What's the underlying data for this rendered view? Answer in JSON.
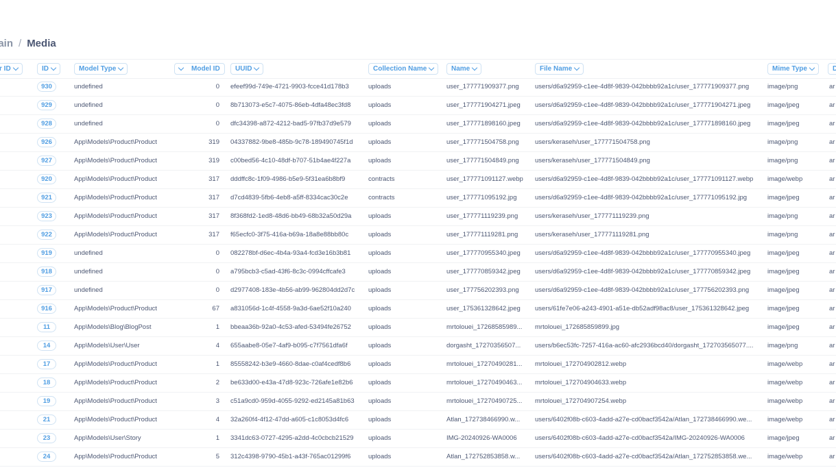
{
  "breadcrumb": {
    "parent": "main",
    "separator": "/",
    "current": "Media"
  },
  "columns": [
    {
      "key": "user_id",
      "label": "r ID"
    },
    {
      "key": "id",
      "label": "ID"
    },
    {
      "key": "model_type",
      "label": "Model Type"
    },
    {
      "key": "model_id",
      "label": "Model ID"
    },
    {
      "key": "uuid",
      "label": "UUID"
    },
    {
      "key": "collection_name",
      "label": "Collection Name"
    },
    {
      "key": "name",
      "label": "Name"
    },
    {
      "key": "file_name",
      "label": "File Name"
    },
    {
      "key": "mime_type",
      "label": "Mime Type"
    },
    {
      "key": "disk",
      "label": "D"
    }
  ],
  "rows": [
    {
      "id": "930",
      "model_type": "undefined",
      "model_id": "0",
      "uuid": "efeef99d-749e-4721-9903-fcce41d178b3",
      "collection_name": "uploads",
      "name": "user_177771909377.png",
      "file_name": "users/d6a92959-c1ee-4d8f-9839-042bbbb92a1c/user_177771909377.png",
      "mime_type": "image/png",
      "disk": "ar"
    },
    {
      "id": "929",
      "model_type": "undefined",
      "model_id": "0",
      "uuid": "8b713073-e5c7-4075-86eb-4dfa48ec3fd8",
      "collection_name": "uploads",
      "name": "user_177771904271.jpeg",
      "file_name": "users/d6a92959-c1ee-4d8f-9839-042bbbb92a1c/user_177771904271.jpeg",
      "mime_type": "image/jpeg",
      "disk": "ar"
    },
    {
      "id": "928",
      "model_type": "undefined",
      "model_id": "0",
      "uuid": "dfc34398-a872-4212-bad5-97fb37d9e579",
      "collection_name": "uploads",
      "name": "user_177771898160.jpeg",
      "file_name": "users/d6a92959-c1ee-4d8f-9839-042bbbb92a1c/user_177771898160.jpeg",
      "mime_type": "image/jpeg",
      "disk": "ar"
    },
    {
      "id": "926",
      "model_type": "App\\Models\\Product\\Product",
      "model_id": "319",
      "uuid": "04337882-9be8-485b-9c78-189490745f1d",
      "collection_name": "uploads",
      "name": "user_177771504758.png",
      "file_name": "users/keraseh/user_177771504758.png",
      "mime_type": "image/png",
      "disk": "ar"
    },
    {
      "id": "927",
      "model_type": "App\\Models\\Product\\Product",
      "model_id": "319",
      "uuid": "c00bed56-4c10-48df-b707-51b4ae4f227a",
      "collection_name": "uploads",
      "name": "user_177771504849.png",
      "file_name": "users/keraseh/user_177771504849.png",
      "mime_type": "image/png",
      "disk": "ar"
    },
    {
      "id": "920",
      "model_type": "App\\Models\\Product\\Product",
      "model_id": "317",
      "uuid": "dddffc8c-1f09-4986-b5e9-5f31ea6b8bf9",
      "collection_name": "contracts",
      "name": "user_177771091127.webp",
      "file_name": "users/d6a92959-c1ee-4d8f-9839-042bbbb92a1c/user_177771091127.webp",
      "mime_type": "image/webp",
      "disk": "ar"
    },
    {
      "id": "921",
      "model_type": "App\\Models\\Product\\Product",
      "model_id": "317",
      "uuid": "d7cd4839-5fb6-4eb8-a5ff-8334cac30c2e",
      "collection_name": "contracts",
      "name": "user_177771095192.jpg",
      "file_name": "users/d6a92959-c1ee-4d8f-9839-042bbbb92a1c/user_177771095192.jpg",
      "mime_type": "image/jpeg",
      "disk": "ar"
    },
    {
      "id": "923",
      "model_type": "App\\Models\\Product\\Product",
      "model_id": "317",
      "uuid": "8f368fd2-1ed8-48d6-bb49-68b32a50d29a",
      "collection_name": "uploads",
      "name": "user_177771119239.png",
      "file_name": "users/keraseh/user_177771119239.png",
      "mime_type": "image/png",
      "disk": "ar"
    },
    {
      "id": "922",
      "model_type": "App\\Models\\Product\\Product",
      "model_id": "317",
      "uuid": "f65ecfc0-3f75-416a-b69a-18a8e88bb80c",
      "collection_name": "uploads",
      "name": "user_177771119281.png",
      "file_name": "users/keraseh/user_177771119281.png",
      "mime_type": "image/png",
      "disk": "ar"
    },
    {
      "id": "919",
      "model_type": "undefined",
      "model_id": "0",
      "uuid": "082278bf-d6ec-4b4a-93a4-fcd3e16b3b81",
      "collection_name": "uploads",
      "name": "user_177770955340.jpeg",
      "file_name": "users/d6a92959-c1ee-4d8f-9839-042bbbb92a1c/user_177770955340.jpeg",
      "mime_type": "image/jpeg",
      "disk": "ar"
    },
    {
      "id": "918",
      "model_type": "undefined",
      "model_id": "0",
      "uuid": "a795bcb3-c5ad-43f6-8c3c-0994cffcafe3",
      "collection_name": "uploads",
      "name": "user_177770859342.jpeg",
      "file_name": "users/d6a92959-c1ee-4d8f-9839-042bbbb92a1c/user_177770859342.jpeg",
      "mime_type": "image/jpeg",
      "disk": "ar"
    },
    {
      "id": "917",
      "model_type": "undefined",
      "model_id": "0",
      "uuid": "d2977408-183e-4b56-ab99-962804dd2d7c",
      "collection_name": "uploads",
      "name": "user_177756202393.png",
      "file_name": "users/d6a92959-c1ee-4d8f-9839-042bbbb92a1c/user_177756202393.png",
      "mime_type": "image/jpeg",
      "disk": "ar"
    },
    {
      "id": "916",
      "model_type": "App\\Models\\Product\\Product",
      "model_id": "67",
      "uuid": "a831056d-1c4f-4558-9a3d-6ae52f10a240",
      "collection_name": "uploads",
      "name": "user_175361328642.jpeg",
      "file_name": "users/61fe7e06-a243-4901-a51e-db52adf98ac8/user_175361328642.jpeg",
      "mime_type": "image/jpeg",
      "disk": "ar"
    },
    {
      "id": "11",
      "model_type": "App\\Models\\Blog\\BlogPost",
      "model_id": "1",
      "uuid": "bbeaa36b-92a0-4c53-afed-53494fe26752",
      "collection_name": "uploads",
      "name": "mrtolouei_17268585989...",
      "file_name": "mrtolouei_172685859899.jpg",
      "mime_type": "image/jpeg",
      "disk": "ar"
    },
    {
      "id": "14",
      "model_type": "App\\Models\\User\\User",
      "model_id": "4",
      "uuid": "655aabe8-05e7-4af9-b095-c7f7561dfa6f",
      "collection_name": "uploads",
      "name": "dorgasht_17270356507...",
      "file_name": "users/b6ec53fc-7257-416a-ac60-afc2936bcd40/dorgasht_172703565077....",
      "mime_type": "image/png",
      "disk": "ar"
    },
    {
      "id": "17",
      "model_type": "App\\Models\\Product\\Product",
      "model_id": "1",
      "uuid": "85558242-b3e9-4660-8dae-c0af4cedf8b6",
      "collection_name": "uploads",
      "name": "mrtolouei_17270490281...",
      "file_name": "mrtolouei_172704902812.webp",
      "mime_type": "image/webp",
      "disk": "ar"
    },
    {
      "id": "18",
      "model_type": "App\\Models\\Product\\Product",
      "model_id": "2",
      "uuid": "be633d00-e43a-47d8-923c-726afe1e82b6",
      "collection_name": "uploads",
      "name": "mrtolouei_17270490463...",
      "file_name": "mrtolouei_172704904633.webp",
      "mime_type": "image/webp",
      "disk": "ar"
    },
    {
      "id": "19",
      "model_type": "App\\Models\\Product\\Product",
      "model_id": "3",
      "uuid": "c51a9cd0-959d-4055-9292-ed2145a81b63",
      "collection_name": "uploads",
      "name": "mrtolouei_17270490725...",
      "file_name": "mrtolouei_172704907254.webp",
      "mime_type": "image/webp",
      "disk": "ar"
    },
    {
      "id": "21",
      "model_type": "App\\Models\\Product\\Product",
      "model_id": "4",
      "uuid": "32a260f4-4f12-47dd-a605-c1c8053d4fc6",
      "collection_name": "uploads",
      "name": "Atlan_172738466990.w...",
      "file_name": "users/6402f08b-c603-4add-a27e-cd0bacf3542a/Atlan_172738466990.we...",
      "mime_type": "image/webp",
      "disk": "ar"
    },
    {
      "id": "23",
      "model_type": "App\\Models\\User\\Story",
      "model_id": "1",
      "uuid": "3341dc63-0727-4295-a2dd-4c0cbcb21529",
      "collection_name": "uploads",
      "name": "IMG-20240926-WA0006",
      "file_name": "users/6402f08b-c603-4add-a27e-cd0bacf3542a/IMG-20240926-WA0006",
      "mime_type": "image/jpeg",
      "disk": "ar"
    },
    {
      "id": "24",
      "model_type": "App\\Models\\Product\\Product",
      "model_id": "5",
      "uuid": "312c4398-9790-45b1-a43f-765ac01299f6",
      "collection_name": "uploads",
      "name": "Atlan_172752853858.w...",
      "file_name": "users/6402f08b-c603-4add-a27e-cd0bacf3542a/Atlan_172752853858.we...",
      "mime_type": "image/webp",
      "disk": "ar"
    }
  ]
}
